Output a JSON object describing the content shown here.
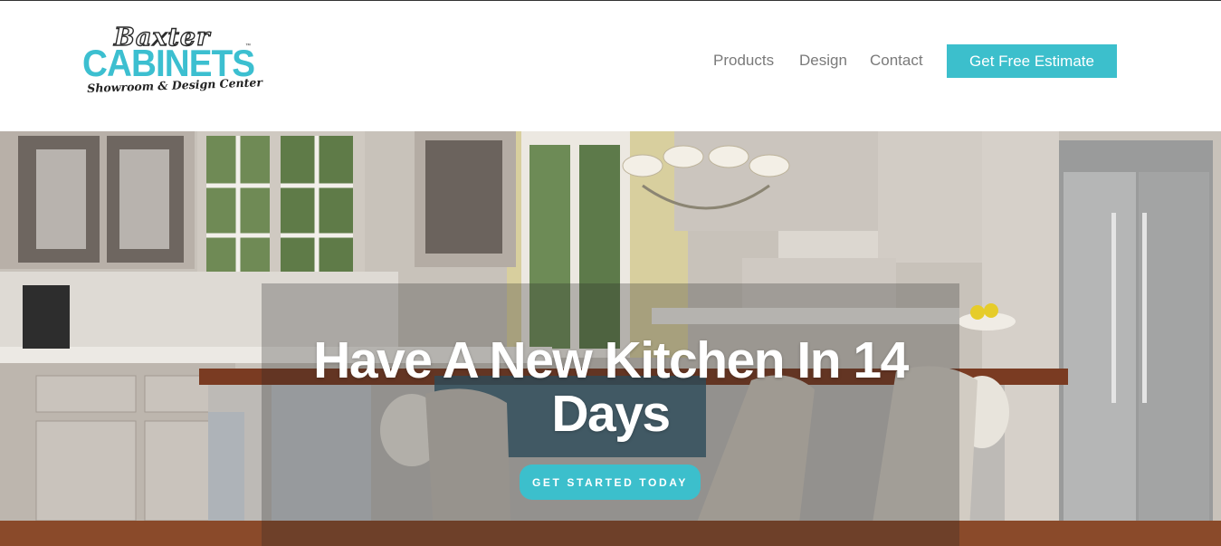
{
  "brand": {
    "logo_top": "Baxter",
    "logo_main": "CABINETS",
    "logo_tm": "™",
    "logo_sub": "Showroom & Design Center",
    "accent_color": "#3cbfcc"
  },
  "nav": {
    "items": [
      {
        "label": "Products"
      },
      {
        "label": "Design"
      },
      {
        "label": "Contact"
      }
    ],
    "cta_label": "Get Free Estimate"
  },
  "hero": {
    "headline": "Have A New Kitchen In 14 Days",
    "cta_label": "GET STARTED TODAY",
    "image": "kitchen-photo"
  }
}
